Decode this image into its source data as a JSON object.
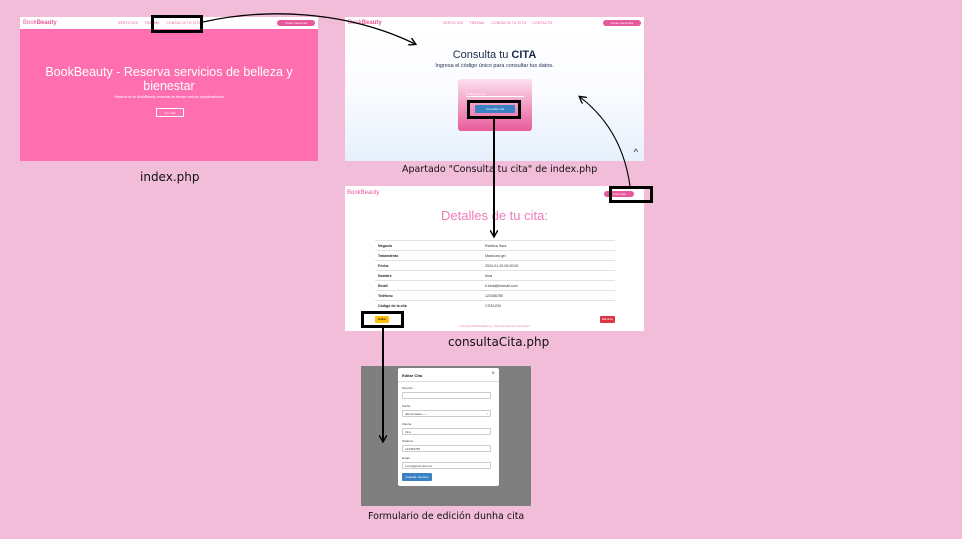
{
  "shot_index": {
    "brand": "Book",
    "brand_bold": "Beauty",
    "nav_links": [
      "SERVICIOS",
      "TRATAM.",
      "CONSULTA TU CITA"
    ],
    "nav_button": "Crear nueva cita",
    "hero_title": "BookBeauty - Reserva servicios de belleza y bienestar",
    "hero_subtitle": "Reserva en tu BookBeauty reservas en tiempo real sin complicaciones",
    "hero_button": "Ver más"
  },
  "shot_consulta": {
    "brand": "Book",
    "brand_bold": "Beauty",
    "nav_links": [
      "SERVICIOS",
      "TRATAM.",
      "CONSULTA TU CITA",
      "CONTACTO"
    ],
    "nav_button": "Crear nueva cita",
    "title_plain": "Consulta tu ",
    "title_bold": "CITA",
    "subtitle": "Ingresa el código único para consultar tus datos.",
    "input_placeholder": "Código de cita",
    "button": "Consultar cita",
    "scroll_up": "^"
  },
  "shot_detalles": {
    "brand": "BookBeauty",
    "nav_button": "Crear cita",
    "title": "Detalles de tu cita:",
    "rows": [
      {
        "k": "Negocio",
        "v": "Estética Sara"
      },
      {
        "k": "Tratamiento",
        "v": "Manicura gel"
      },
      {
        "k": "Fecha",
        "v": "2024-01-20 09:30:00"
      },
      {
        "k": "Nombre",
        "v": "Irina"
      },
      {
        "k": "Email",
        "v": "ti.irina@hotmail.com"
      },
      {
        "k": "Teléfono",
        "v": "123456789"
      },
      {
        "k": "Código de la cita",
        "v": "CITA1234"
      }
    ],
    "edit_button": "Editar",
    "delete_button": "Eliminar",
    "footnote": "Copyright 2024 BookBeauty | Todos los derechos reservados"
  },
  "shot_editar": {
    "title": "Editar Cita",
    "close": "×",
    "fields": [
      {
        "label": "Servicio",
        "value": ""
      },
      {
        "label": "Fecha",
        "value": "dd/mm/aaaa --:--"
      },
      {
        "label": "Cliente",
        "value": "Irina"
      },
      {
        "label": "Teléfono",
        "value": "123456789"
      },
      {
        "label": "Email",
        "value": "ti.irina@hotmail.com"
      }
    ],
    "save_button": "Guardar cambios"
  },
  "captions": {
    "index": "index.php",
    "consulta": "Apartado \"Consulta tu cita\" de index.php",
    "detalles": "consultaCita.php",
    "editar": "Formulario de edición dunha cita"
  }
}
